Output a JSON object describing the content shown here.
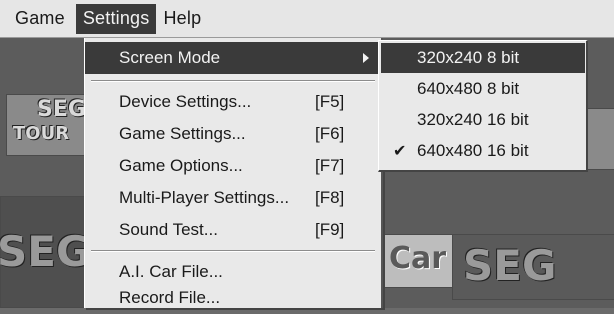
{
  "menubar": {
    "game": "Game",
    "settings": "Settings",
    "help": "Help"
  },
  "background": {
    "logo_left_top": "SEG",
    "logo_left_top2": "TOUR",
    "logo_left_mid": "SEG",
    "car_text": "Car",
    "logo_right_mid": "SEG"
  },
  "settings_menu": {
    "items": [
      {
        "label": "Screen Mode",
        "accel": ""
      },
      {
        "label": "Device Settings...",
        "accel": "[F5]"
      },
      {
        "label": "Game Settings...",
        "accel": "[F6]"
      },
      {
        "label": "Game Options...",
        "accel": "[F7]"
      },
      {
        "label": "Multi-Player Settings...",
        "accel": "[F8]"
      },
      {
        "label": "Sound Test...",
        "accel": "[F9]"
      },
      {
        "label": "A.I. Car File...",
        "accel": ""
      },
      {
        "label": "Record File...",
        "accel": ""
      }
    ]
  },
  "screen_mode_submenu": {
    "items": [
      {
        "label": "320x240 8 bit",
        "checked": false
      },
      {
        "label": "640x480 8 bit",
        "checked": false
      },
      {
        "label": "320x240 16 bit",
        "checked": false
      },
      {
        "label": "640x480 16 bit",
        "checked": true
      }
    ],
    "check_glyph": "✔"
  }
}
